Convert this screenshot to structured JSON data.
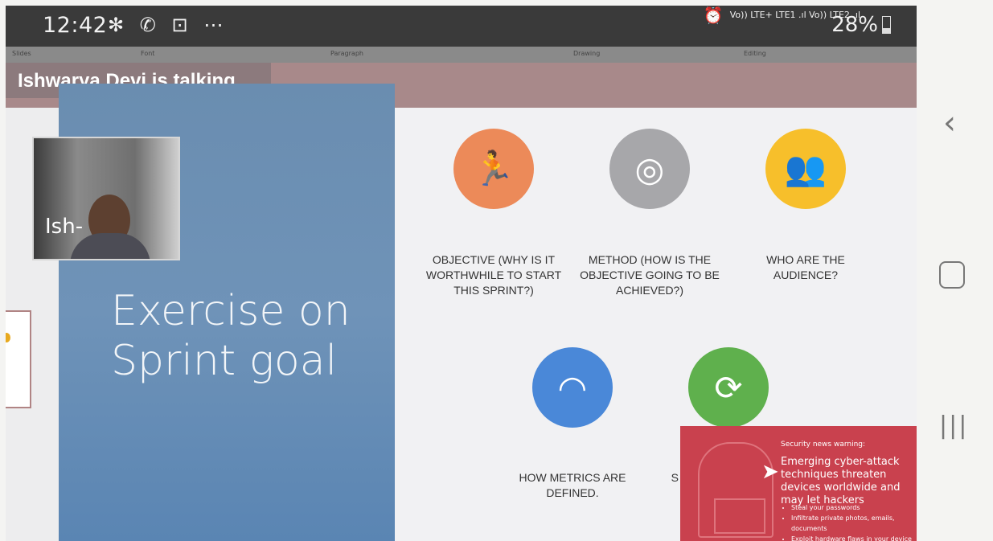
{
  "status_bar": {
    "time": "12:42",
    "icons": [
      "snowflake-icon",
      "whatsapp-icon",
      "app-icon",
      "more-icon"
    ],
    "network": "Vo)) LTE+ LTE1 .ıl Vo)) LTE2 .ıl",
    "battery": "28%",
    "battery_fraction": 0.28
  },
  "ribbon": {
    "groups": [
      "Slides",
      "Font",
      "Paragraph",
      "Drawing",
      "Editing"
    ]
  },
  "call": {
    "talking_label": "Ishwarya Devi is talking",
    "participant_tile": "Ish-"
  },
  "slide": {
    "title_line1": "Exercise on",
    "title_line2": "Sprint goal",
    "items": [
      {
        "label": "OBJECTIVE (WHY IS IT WORTHWHILE TO START THIS SPRINT?)",
        "color": "#ec8a59",
        "icon": "running-icon"
      },
      {
        "label": "METHOD (HOW IS THE OBJECTIVE GOING TO BE ACHIEVED?)",
        "color": "#a7a7aa",
        "icon": "target-icon"
      },
      {
        "label": "WHO ARE THE AUDIENCE?",
        "color": "#f7bf2b",
        "icon": "audience-icon"
      },
      {
        "label": "HOW METRICS ARE DEFINED.",
        "color": "#4a88d8",
        "icon": "gauge-icon"
      },
      {
        "label": "S",
        "color": "#5fb04d",
        "icon": "refresh-icon"
      }
    ]
  },
  "warning": {
    "title": "Security news warning:",
    "message": "Emerging cyber-attack techniques threaten devices worldwide and may let hackers",
    "bullets": [
      "Steal your passwords",
      "Infiltrate private photos, emails, documents",
      "Exploit hardware flaws in your device"
    ]
  },
  "nav": {
    "back": "‹",
    "recent": "|||"
  }
}
